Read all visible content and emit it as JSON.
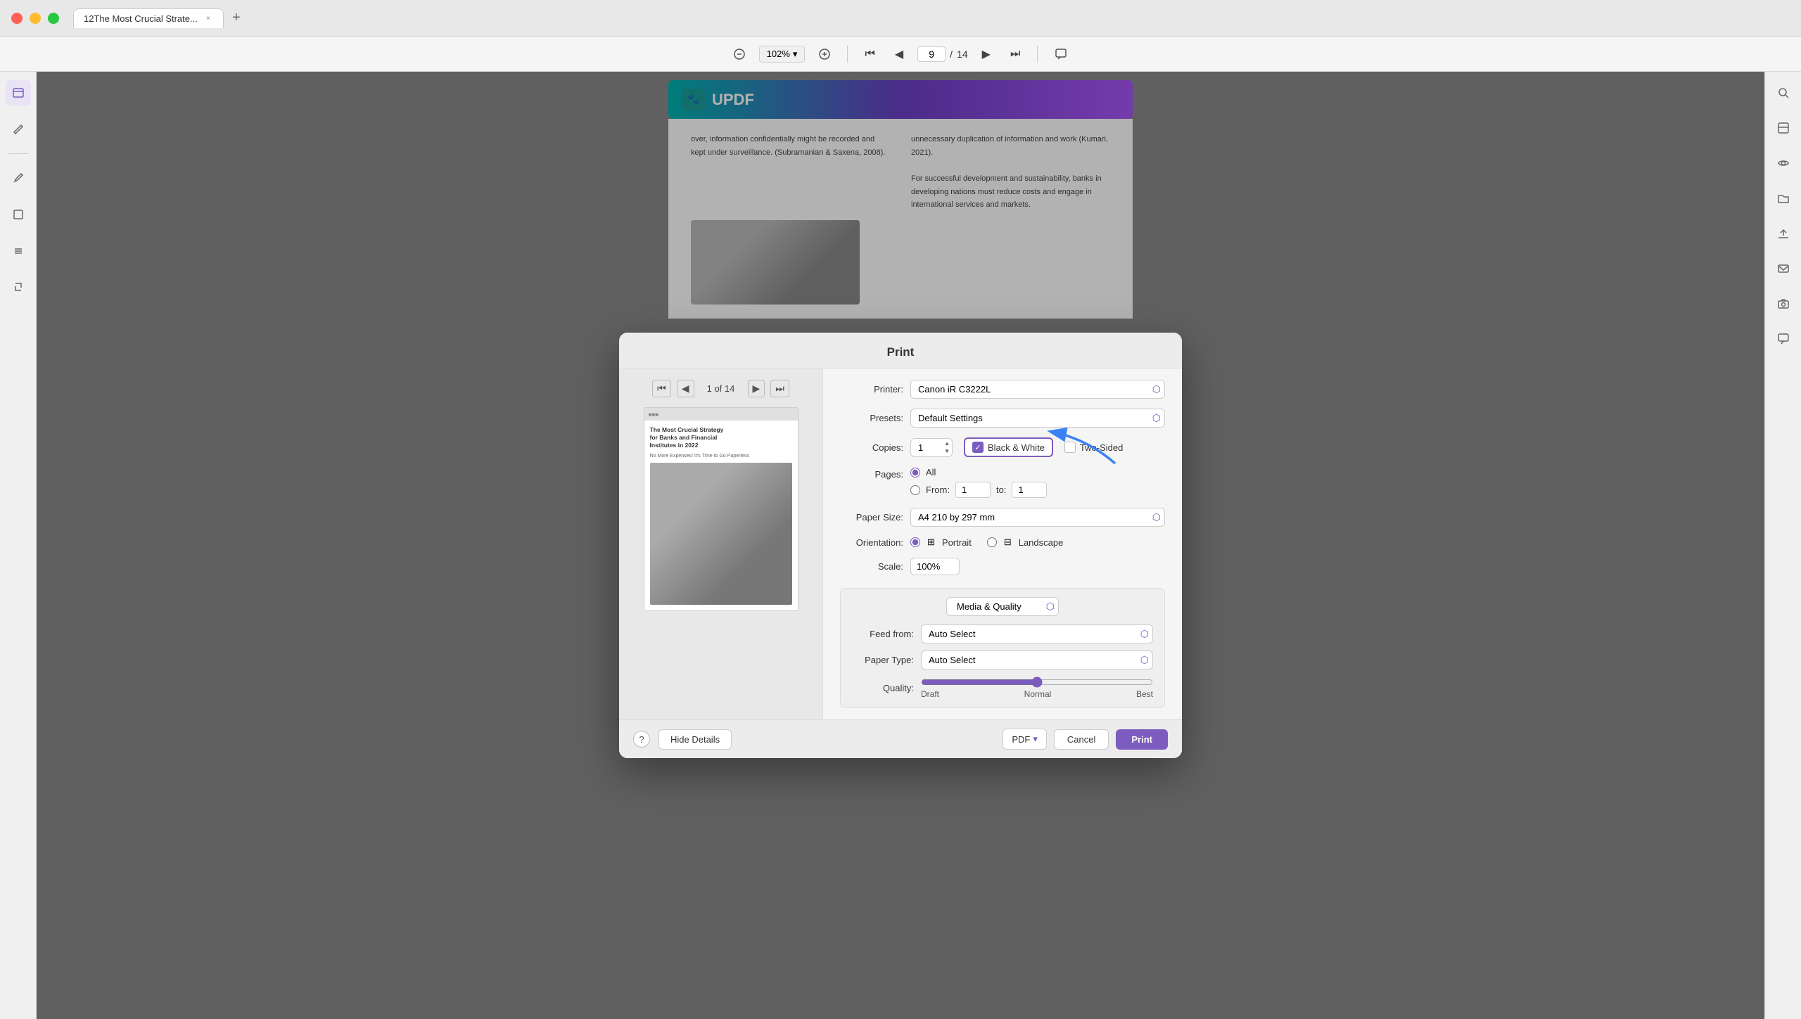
{
  "window": {
    "title": "12The Most Crucial Strate...",
    "tab_close": "×",
    "new_tab": "+"
  },
  "toolbar": {
    "zoom_level": "102%",
    "page_current": "9",
    "page_total": "14",
    "zoom_in_label": "+",
    "zoom_out_label": "−"
  },
  "updf_banner": {
    "logo_text": "🐾",
    "brand_name": "UPDF"
  },
  "document_text": {
    "col1_p1": "over, information confidentially might be recorded and kept under surveillance. (Subramanian & Saxena, 2008).",
    "col2_p1": "unnecessary duplication of information and work (Kumari, 2021).",
    "col2_p2": "For successful development and sustainability, banks in developing nations must reduce costs and engage in international services and markets."
  },
  "print_dialog": {
    "title": "Print",
    "preview": {
      "page_label": "1 of 14",
      "doc_title_line1": "The Most Crucial Strategy",
      "doc_title_line2": "for Banks and Financial",
      "doc_title_line3": "Institutes in 2022",
      "doc_subtitle": "No More Expenses! It's Time to Go Paperless"
    },
    "printer_label": "Printer:",
    "printer_value": "Canon iR C3222L",
    "presets_label": "Presets:",
    "presets_value": "Default Settings",
    "copies_label": "Copies:",
    "copies_value": "1",
    "bw_label": "Black & White",
    "twosided_label": "Two-Sided",
    "pages_label": "Pages:",
    "pages_all": "All",
    "pages_from_label": "From:",
    "pages_from_value": "1",
    "pages_to_label": "to:",
    "pages_to_value": "1",
    "papersize_label": "Paper Size:",
    "papersize_value": "A4",
    "papersize_dims": "210 by 297 mm",
    "orientation_label": "Orientation:",
    "orientation_portrait": "Portrait",
    "orientation_landscape": "Landscape",
    "scale_label": "Scale:",
    "scale_value": "100%",
    "media_quality_header": "Media & Quality",
    "feed_from_label": "Feed from:",
    "feed_from_value": "Auto Select",
    "paper_type_label": "Paper Type:",
    "paper_type_value": "Auto Select",
    "quality_label": "Quality:",
    "quality_draft": "Draft",
    "quality_normal": "Normal",
    "quality_best": "Best",
    "help_btn": "?",
    "hide_details_btn": "Hide Details",
    "pdf_btn": "PDF",
    "cancel_btn": "Cancel",
    "print_btn": "Print"
  },
  "sidebar_left": {
    "icons": [
      "📄",
      "✏️",
      "✍️",
      "📌",
      "🗂️",
      "📋"
    ]
  },
  "sidebar_right": {
    "icons": [
      "🔍",
      "🖥️",
      "👁️",
      "📁",
      "⬆️",
      "📧",
      "📷",
      "💬"
    ]
  }
}
